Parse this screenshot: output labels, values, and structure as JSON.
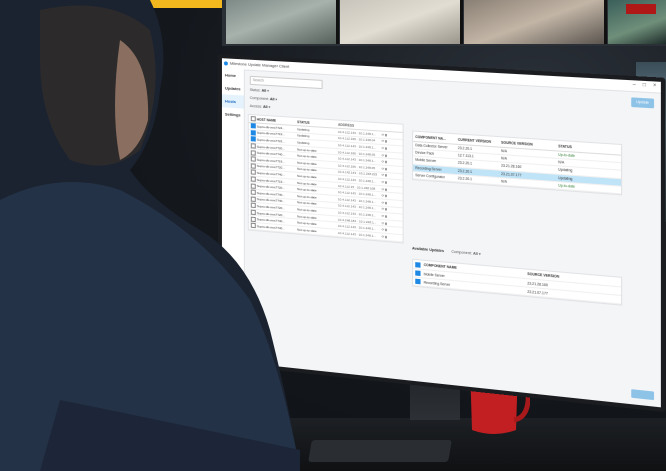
{
  "app": {
    "title": "Milestone Update Manager Client"
  },
  "window_controls": {
    "minimize": "–",
    "maximize": "□",
    "close": "×"
  },
  "sidebar": {
    "items": [
      {
        "label": "Home"
      },
      {
        "label": "Updates"
      },
      {
        "label": "Hosts"
      },
      {
        "label": "Settings"
      }
    ]
  },
  "search": {
    "placeholder": "Search"
  },
  "filters": [
    {
      "label": "Status:",
      "value": "All"
    },
    {
      "label": "Component:",
      "value": "All"
    },
    {
      "label": "Access:",
      "value": "All"
    }
  ],
  "update_button": {
    "label": "Update"
  },
  "host_table": {
    "headers": [
      "HOST NAME",
      "STATUS",
      "ADDRESS"
    ],
    "rows": [
      {
        "host": "Supro-dk-vms7724...",
        "status": "Updating",
        "address": "10.4.112.143 · 10.1.248.1...",
        "checked": true
      },
      {
        "host": "Supro-dk-vms7719...",
        "status": "Updating",
        "address": "10.4.112.166 · 10.1.248.04",
        "checked": true
      },
      {
        "host": "Supro-dk-vms7722...",
        "status": "Updating",
        "address": "10.4.112.143 · 10.1.248.1...",
        "checked": true
      },
      {
        "host": "Supro-dk-vms7720...",
        "status": "Not up-to-date",
        "address": "10.4.112.166 · 10.1.248.05",
        "checked": false
      },
      {
        "host": "Supro-dk-vms7740...",
        "status": "Not up-to-date",
        "address": "10.4.112.143 · 10.1.248.1...",
        "checked": false
      },
      {
        "host": "Supro-dk-vms7719...",
        "status": "Not up-to-date",
        "address": "10.4.112.166 · 10.1.248.05",
        "checked": false
      },
      {
        "host": "Supro-dk-vms7720...",
        "status": "Not up-to-date",
        "address": "10.4.142.143 · 10.1.248.223",
        "checked": false
      },
      {
        "host": "Supro-dk-vms7740...",
        "status": "Not up-to-date",
        "address": "10.4.112.143 · 10.1.248.1...",
        "checked": false
      },
      {
        "host": "Supro-dk-vms7719...",
        "status": "Not up-to-date",
        "address": "10.4.112.15 · 10.1.248.108",
        "checked": false
      },
      {
        "host": "Supro-dk-vms7720...",
        "status": "Not up-to-date",
        "address": "10.4.112.143 · 10.1.248.1...",
        "checked": false
      },
      {
        "host": "Supro-dk-vms7740...",
        "status": "Not up-to-date",
        "address": "10.4.112.143 · 10.1.248.1...",
        "checked": false
      },
      {
        "host": "Supro-dk-vms7740...",
        "status": "Not up-to-date",
        "address": "10.4.112.143 · 10.1.248.1...",
        "checked": false
      },
      {
        "host": "Supro-dk-vms7720...",
        "status": "Not up-to-date",
        "address": "10.4.112.143 · 10.1.248.1...",
        "checked": false
      },
      {
        "host": "Supro-dk-vms7720...",
        "status": "Not up-to-date",
        "address": "10.4.248.184 · 10.1.248.1...",
        "checked": false
      },
      {
        "host": "Supro-dk-vms7740...",
        "status": "Not up-to-date",
        "address": "10.4.112.143 · 10.1.248.1...",
        "checked": false
      },
      {
        "host": "Supro-dk-vms7740...",
        "status": "Not up-to-date",
        "address": "10.4.112.143 · 10.1.248.1...",
        "checked": false
      }
    ]
  },
  "component_table": {
    "headers": [
      "COMPONENT NA...",
      "CURRENT VERSION",
      "SOURCE VERSION",
      "STATUS"
    ],
    "rows": [
      {
        "name": "Data Collector Server",
        "current": "23.2.20.1",
        "source": "N/A",
        "status": "Up-to-date",
        "selected": false
      },
      {
        "name": "Device Pack",
        "current": "12.7.113.1",
        "source": "N/A",
        "status": "N/A",
        "selected": false
      },
      {
        "name": "Mobile Server",
        "current": "23.2.20.1",
        "source": "23.21.28.160",
        "status": "Updating",
        "selected": false
      },
      {
        "name": "Recording Server",
        "current": "23.2.20.1",
        "source": "23.21.07.177",
        "status": "Updating",
        "selected": true
      },
      {
        "name": "Server Configurator",
        "current": "23.2.20.1",
        "source": "N/A",
        "status": "Up-to-date",
        "selected": false
      }
    ]
  },
  "available_updates": {
    "title": "Available Updates",
    "component_label": "Component:",
    "component_value": "All",
    "headers": [
      "COMPONENT NAME",
      "SOURCE VERSION"
    ],
    "rows": [
      {
        "name": "Mobile Server",
        "source": "23.21.28.160"
      },
      {
        "name": "Recording Server",
        "source": "23.21.07.177"
      }
    ]
  }
}
